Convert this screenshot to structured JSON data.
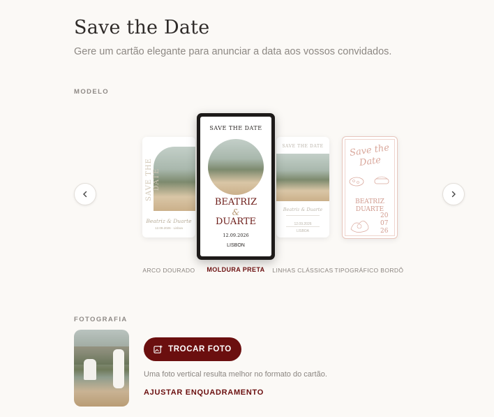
{
  "header": {
    "title": "Save the Date",
    "subtitle": "Gere um cartão elegante para anunciar a data aos vossos convidados."
  },
  "model_section": {
    "label": "MODELO",
    "prev_icon": "chevron-left-icon",
    "next_icon": "chevron-right-icon",
    "selected": "MOLDURA PRETA",
    "templates": [
      {
        "caption": "ARCO DOURADO",
        "card_text": {
          "vertical": "SAVE THE DATE",
          "names": "Beatriz & Duarte",
          "footer": "12.09.2026 · Lisboa"
        }
      },
      {
        "caption": "MOLDURA PRETA",
        "card_text": {
          "heading": "SAVE THE DATE",
          "name1": "BEATRIZ",
          "amp": "&",
          "name2": "DUARTE",
          "date": "12.09.2026",
          "place": "LISBON"
        }
      },
      {
        "caption": "LINHAS CLÁSSICAS",
        "card_text": {
          "heading": "SAVE THE DATE",
          "names": "Beatriz & Duarte",
          "line1": "12.09.2026",
          "line2": "LISBOA"
        }
      },
      {
        "caption": "TIPOGRÁFICO BORDÔ",
        "card_text": {
          "script1": "Save the",
          "script2": "Date",
          "name1": "BEATRIZ",
          "name2": "DUARTE",
          "d1": "20",
          "d2": "07",
          "d3": "26"
        }
      }
    ]
  },
  "photo_section": {
    "label": "FOTOGRAFIA",
    "change_button": "TROCAR FOTO",
    "change_icon": "image-plus-icon",
    "hint": "Uma foto vertical resulta melhor no formato do cartão.",
    "adjust_link": "AJUSTAR ENQUADRAMENTO"
  },
  "colors": {
    "accent": "#6b0f0f",
    "background": "#fbf9f6",
    "bordo": "#c98f84"
  }
}
